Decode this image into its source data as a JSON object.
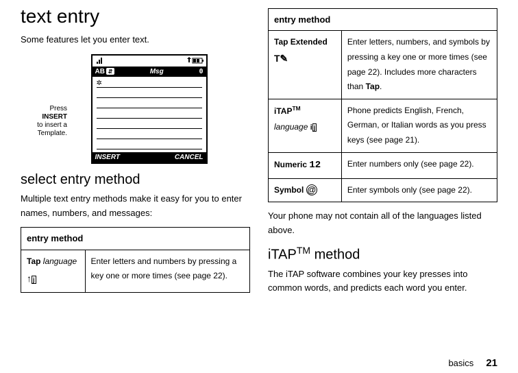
{
  "left": {
    "h1": "text entry",
    "p1": "Some features let you enter text.",
    "callout_line1": "Press",
    "callout_bold": "INSERT",
    "callout_line2": "to insert a",
    "callout_line3": "Template.",
    "phone_mode": "AB",
    "phone_title": "Msg",
    "phone_count": "0",
    "phone_left": "INSERT",
    "phone_right": "CANCEL",
    "phone_cursor": "✲",
    "h2": "select entry method",
    "p2": "Multiple text entry methods make it easy for you to enter names, numbers, and messages:",
    "table_header": "entry method",
    "row_tap_bold": "Tap",
    "row_tap_lang": " language",
    "row_tap_icon": "⬆⬇",
    "row_tap_desc": "Enter letters and numbers by pressing a key one or more times (see page 22)."
  },
  "right": {
    "table_header": "entry method",
    "r1_bold": "Tap Extended",
    "r1_icon": "T✎",
    "r1_desc": "Enter letters, numbers, and symbols by pressing a key one or more times (see page 22). Includes more characters than ",
    "r1_desc_end": "Tap",
    "r1_desc_dot": ".",
    "r2_bold": "iTAP",
    "r2_tm": "TM",
    "r2_lang": "language",
    "r2_icon": "i⬇",
    "r2_desc": "Phone predicts English, French, German, or Italian words as you press keys (see page 21).",
    "r3_bold": "Numeric",
    "r3_icon": "12",
    "r3_desc": "Enter numbers only (see page 22).",
    "r4_bold": "Symbol",
    "r4_icon": "@",
    "r4_desc": "Enter symbols only (see page 22).",
    "p_after": "Your phone may not contain all of the languages listed above.",
    "h2": "iTAP",
    "h2_tm": "TM",
    "h2_end": " method",
    "p2": "The iTAP software combines your key presses into common words, and predicts each word you enter."
  },
  "footer": {
    "section": "basics",
    "page": "21"
  }
}
